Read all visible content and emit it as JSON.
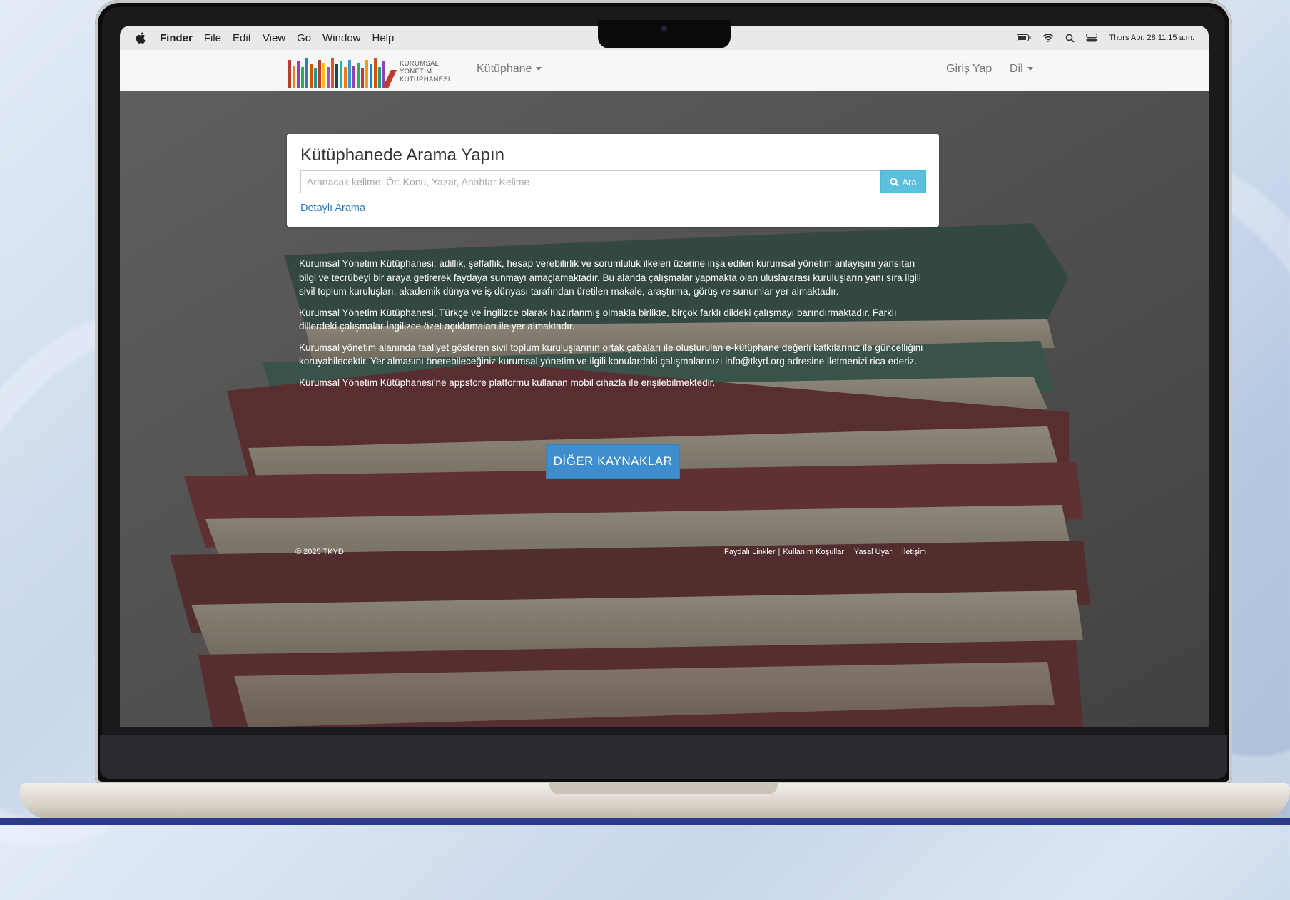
{
  "menubar": {
    "items": [
      "Finder",
      "File",
      "Edit",
      "View",
      "Go",
      "Window",
      "Help"
    ],
    "clock": "Thurs Apr. 28 11:15 a.m."
  },
  "navbar": {
    "logo_lines": [
      "KURUMSAL",
      "YÖNETİM",
      "KÜTÜPHANESİ"
    ],
    "library_menu": "Kütüphane",
    "login": "Giriş Yap",
    "language": "Dil"
  },
  "search": {
    "title": "Kütüphanede Arama Yapın",
    "placeholder": "Aranacak kelime. Ör: Konu, Yazar, Anahtar Kelime",
    "value": "",
    "button_label": "Ara",
    "advanced_link": "Detaylı Arama"
  },
  "about": {
    "paragraphs": [
      "Kurumsal Yönetim Kütüphanesi; adillik, şeffaflık, hesap verebilirlik ve sorumluluk ilkeleri üzerine inşa edilen kurumsal yönetim anlayışını yansıtan bilgi ve tecrübeyi bir araya getirerek faydaya sunmayı amaçlamaktadır. Bu alanda çalışmalar yapmakta olan uluslararası kuruluşların yanı sıra ilgili sivil toplum kuruluşları, akademik dünya ve iş dünyası tarafından üretilen makale, araştırma, görüş ve sunumlar yer almaktadır.",
      "Kurumsal Yönetim Kütüphanesi, Türkçe ve İngilizce olarak hazırlanmış olmakla birlikte, birçok farklı dildeki çalışmayı barındırmaktadır. Farklı dillerdeki çalışmalar İngilizce özet açıklamaları ile yer almaktadır.",
      "Kurumsal yönetim alanında faaliyet gösteren sivil toplum kuruluşlarının ortak çabaları ile oluşturulan e-kütüphane değerli katkılarınız ile güncelliğini koruyabilecektir. Yer almasını önerebileceğiniz kurumsal yönetim ve ilgili konulardaki çalışmalarınızı info@tkyd.org adresine iletmenizi rica ederiz.",
      "Kurumsal Yönetim Kütüphanesi'ne appstore platformu kullanan mobil cihazla ile erişilebilmektedir."
    ]
  },
  "more_resources_button": "DİĞER KAYNAKLAR",
  "footer": {
    "copyright": "© 2025 TKYD",
    "links": [
      "Faydalı Linkler",
      "Kullanım Koşulları",
      "Yasal Uyarı",
      "İletişim"
    ],
    "separator": "|"
  },
  "colors": {
    "primary_button": "#3e8ece",
    "search_button": "#5bc0de",
    "link": "#337ab7",
    "navbar_bg": "#f7f7f7"
  }
}
